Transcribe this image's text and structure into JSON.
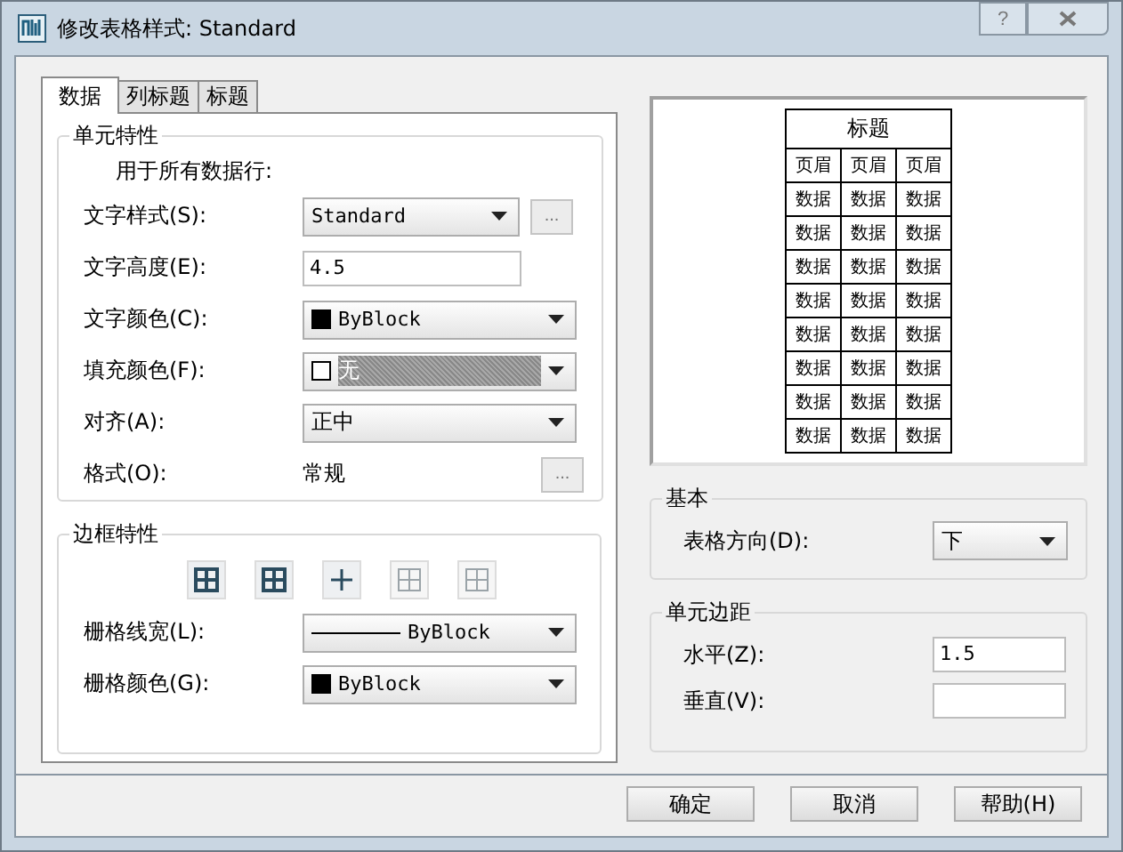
{
  "window": {
    "title": "修改表格样式: Standard",
    "help_button": "?"
  },
  "tabs": [
    {
      "label": "数据",
      "selected": true
    },
    {
      "label": "列标题",
      "selected": false
    },
    {
      "label": "标题",
      "selected": false
    }
  ],
  "cell_properties": {
    "title": "单元特性",
    "note": "用于所有数据行:",
    "rows": [
      {
        "kind": "dropdown",
        "label": "文字样式(S):",
        "value": "Standard",
        "more_button": "..."
      },
      {
        "kind": "input",
        "label": "文字高度(E):",
        "value": "4.5"
      },
      {
        "kind": "color_dropdown",
        "label": "文字颜色(C):",
        "value": "ByBlock",
        "swatch_filled": true,
        "highlighted": false
      },
      {
        "kind": "color_dropdown",
        "label": "填充颜色(F):",
        "value": "无",
        "swatch_filled": false,
        "highlighted": true
      },
      {
        "kind": "dropdown",
        "label": "对齐(A):",
        "value": "正中"
      },
      {
        "kind": "text",
        "label": "格式(O):",
        "value": "常规",
        "more_button": "..."
      }
    ]
  },
  "border_properties": {
    "title": "边框特性",
    "border_buttons": [
      {
        "disabled": false
      },
      {
        "disabled": false
      },
      {
        "disabled": false
      },
      {
        "disabled": true
      },
      {
        "disabled": true
      }
    ],
    "rows": [
      {
        "kind": "lineweight_dropdown",
        "label": "栅格线宽(L):",
        "value": "ByBlock"
      },
      {
        "kind": "color_dropdown",
        "label": "栅格颜色(G):",
        "value": "ByBlock",
        "swatch_filled": true,
        "highlighted": false
      }
    ]
  },
  "preview": {
    "title": "标题",
    "header": [
      "页眉",
      "页眉",
      "页眉"
    ],
    "rows": [
      [
        "数据",
        "数据",
        "数据"
      ],
      [
        "数据",
        "数据",
        "数据"
      ],
      [
        "数据",
        "数据",
        "数据"
      ],
      [
        "数据",
        "数据",
        "数据"
      ],
      [
        "数据",
        "数据",
        "数据"
      ],
      [
        "数据",
        "数据",
        "数据"
      ],
      [
        "数据",
        "数据",
        "数据"
      ],
      [
        "数据",
        "数据",
        "数据"
      ]
    ]
  },
  "basic": {
    "title": "基本",
    "label": "表格方向(D):",
    "value": "下"
  },
  "margins": {
    "title": "单元边距",
    "horizontal": {
      "label": "水平(Z):",
      "value": "1.5"
    },
    "vertical": {
      "label": "垂直(V):"
    }
  },
  "buttons": [
    "确定",
    "取消",
    "帮助(H)"
  ]
}
